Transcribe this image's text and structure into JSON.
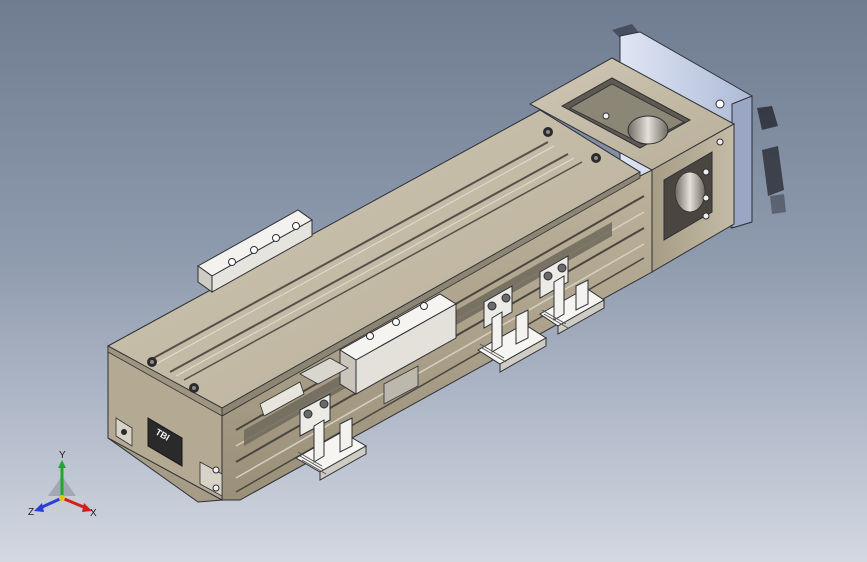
{
  "viewport": {
    "background_top": "#6f7c91",
    "background_bottom": "#d3d8e1"
  },
  "model": {
    "body_color": "#b8ae98",
    "flange_color": "#c5cfe6",
    "bracket_color": "#ecebe6",
    "logo_text": "TBI"
  },
  "triad": {
    "y_label": "Y",
    "x_label": "X",
    "z_label": "Z",
    "y_color": "#1fa82c",
    "x_color": "#d21f1f",
    "z_color": "#2b3fd6"
  }
}
